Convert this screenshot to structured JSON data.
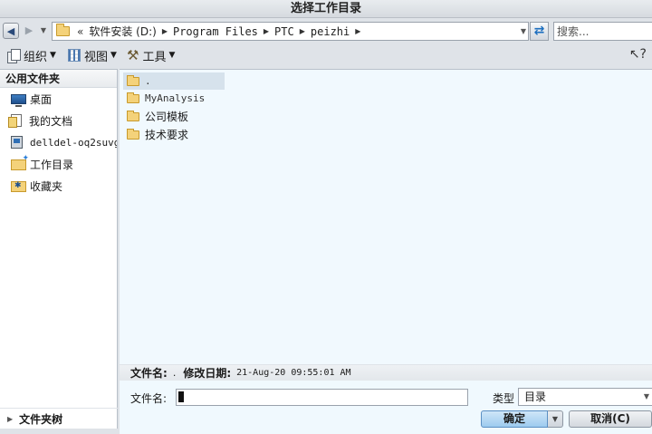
{
  "window": {
    "title": "选择工作目录"
  },
  "address": {
    "overflow": "«",
    "crumbs": [
      "软件安装 (D:)",
      "Program Files",
      "PTC",
      "peizhi"
    ]
  },
  "search": {
    "placeholder": "搜索..."
  },
  "toolbar": {
    "organize": "组织",
    "view": "视图",
    "tools": "工具"
  },
  "sidebar": {
    "header": "公用文件夹",
    "items": [
      {
        "label": "桌面",
        "icon": "desktop-icon"
      },
      {
        "label": "我的文档",
        "icon": "documents-icon"
      },
      {
        "label": "delldel-oq2suvg",
        "icon": "computer-icon"
      },
      {
        "label": "工作目录",
        "icon": "working-directory-icon"
      },
      {
        "label": "收藏夹",
        "icon": "favorites-icon"
      }
    ],
    "tree_toggle": "文件夹树"
  },
  "files": [
    {
      "name": ".",
      "selected": true
    },
    {
      "name": "MyAnalysis"
    },
    {
      "name": "公司模板"
    },
    {
      "name": "技术要求"
    }
  ],
  "details": {
    "name_label": "文件名:",
    "name_value": ".",
    "date_label": "修改日期:",
    "date_value": "21-Aug-20 09:55:01 AM"
  },
  "form": {
    "filename_label": "文件名:",
    "filename_value": "",
    "type_label": "类型",
    "type_value": "目录",
    "ok": "确定",
    "cancel": "取消(C)"
  }
}
